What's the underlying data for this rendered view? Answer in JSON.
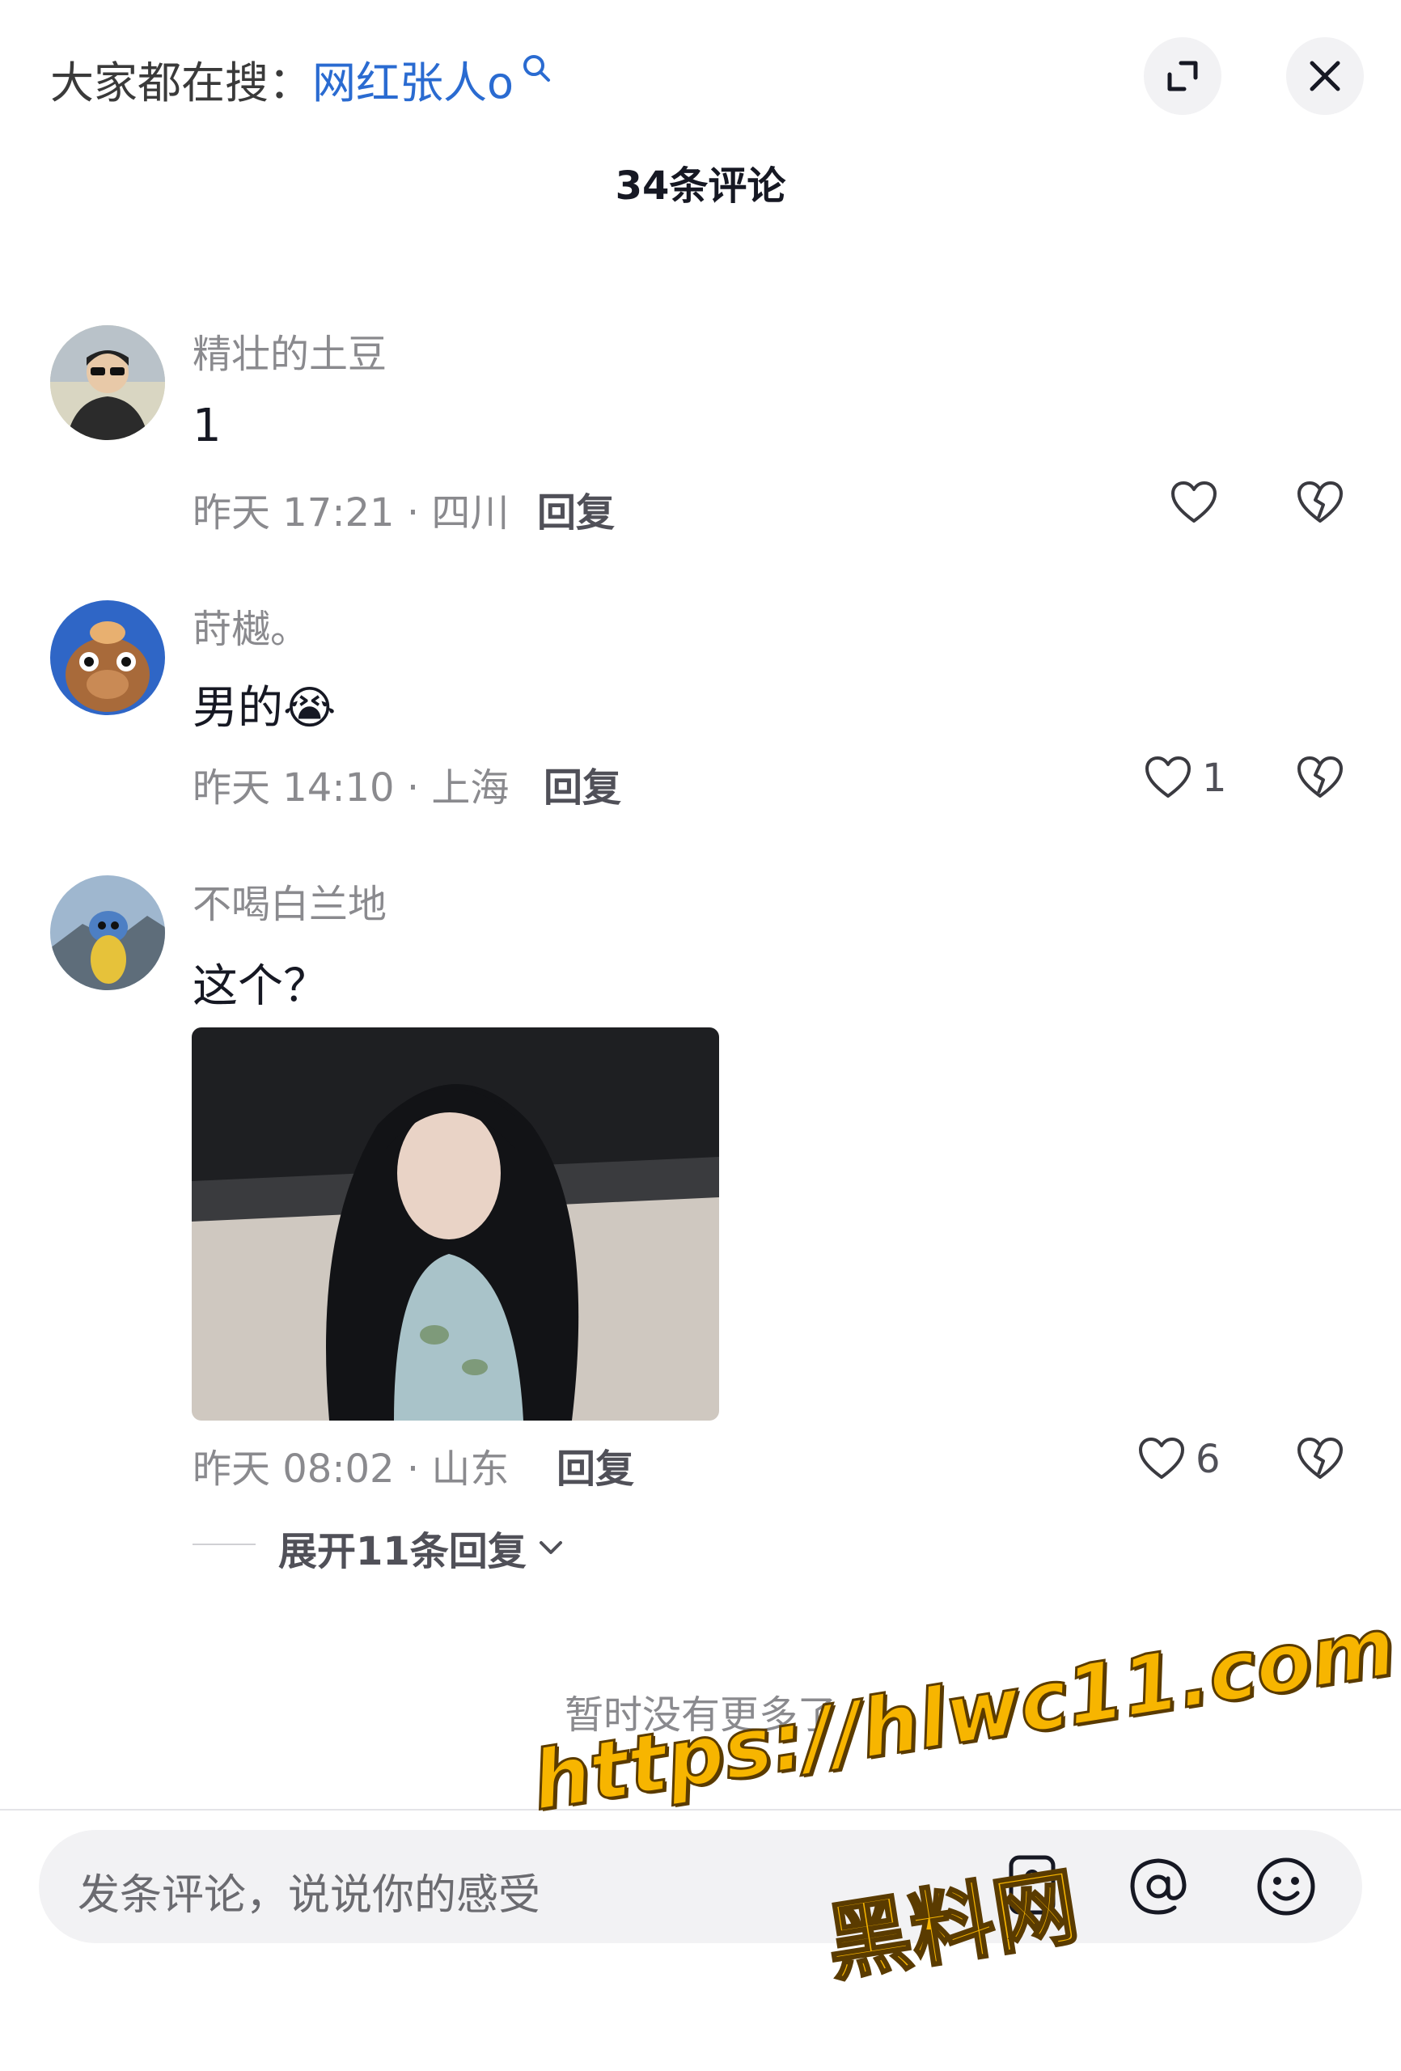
{
  "header": {
    "hot_search_prefix": "大家都在搜：",
    "hot_search_keyword": "网红张人o"
  },
  "comment_count": "34条评论",
  "comments": [
    {
      "username": "精壮的土豆",
      "text": "1",
      "time_location": "昨天 17:21 · 四川",
      "reply_label": "回复",
      "likes": ""
    },
    {
      "username": "莳樾。",
      "text": "男的",
      "emoji": "😭",
      "time_location": "昨天 14:10 · 上海",
      "reply_label": "回复",
      "likes": "1"
    },
    {
      "username": "不喝白兰地",
      "text": "这个？",
      "time_location": "昨天 08:02 · 山东",
      "reply_label": "回复",
      "likes": "6",
      "expand_replies": "展开11条回复"
    }
  ],
  "no_more": "暂时没有更多了",
  "input": {
    "placeholder": "发条评论，说说你的感受"
  },
  "watermark": {
    "url": "https://hlwc11.com",
    "site": "黑料网"
  },
  "colors": {
    "keyword": "#2a6bd1",
    "watermark": "#f7b500"
  }
}
